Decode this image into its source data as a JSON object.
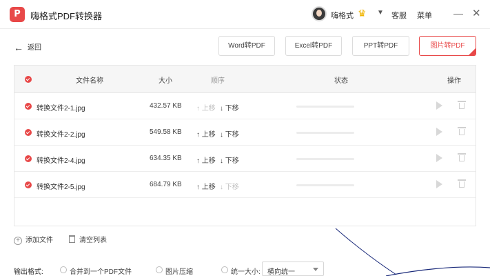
{
  "app": {
    "logo_letter": "P",
    "title": "嗨格式PDF转换器",
    "username": "嗨格式",
    "service_label": "客服",
    "menu_label": "菜单",
    "minimize_glyph": "—",
    "close_glyph": "✕",
    "crown_glyph": "♛",
    "dropdown_glyph": "▼"
  },
  "toolbar": {
    "back_label": "返回",
    "back_glyph": "←",
    "modes": [
      {
        "label": "Word转PDF",
        "active": false
      },
      {
        "label": "Excel转PDF",
        "active": false
      },
      {
        "label": "PPT转PDF",
        "active": false
      },
      {
        "label": "图片转PDF",
        "active": true
      }
    ]
  },
  "table": {
    "headers": {
      "name": "文件名称",
      "size": "大小",
      "order": "顺序",
      "status": "状态",
      "action": "操作"
    },
    "rows": [
      {
        "name": "转换文件2-1.jpg",
        "size": "432.57 KB",
        "up": "上移",
        "down": "下移",
        "up_enabled": false,
        "down_enabled": true,
        "progress": 0
      },
      {
        "name": "转换文件2-2.jpg",
        "size": "549.58 KB",
        "up": "上移",
        "down": "下移",
        "up_enabled": true,
        "down_enabled": true,
        "progress": 0
      },
      {
        "name": "转换文件2-4.jpg",
        "size": "634.35 KB",
        "up": "上移",
        "down": "下移",
        "up_enabled": true,
        "down_enabled": true,
        "progress": 0
      },
      {
        "name": "转换文件2-5.jpg",
        "size": "684.79 KB",
        "up": "上移",
        "down": "下移",
        "up_enabled": true,
        "down_enabled": false,
        "progress": 0
      }
    ]
  },
  "actions": {
    "add_file": "添加文件",
    "clear_list": "清空列表"
  },
  "output": {
    "label": "输出格式:",
    "options": [
      "合并到一个PDF文件",
      "图片压缩",
      "统一大小:"
    ],
    "select_value": "横向统一"
  },
  "colors": {
    "accent": "#e84848",
    "annotation_line": "#1a2a7a"
  }
}
